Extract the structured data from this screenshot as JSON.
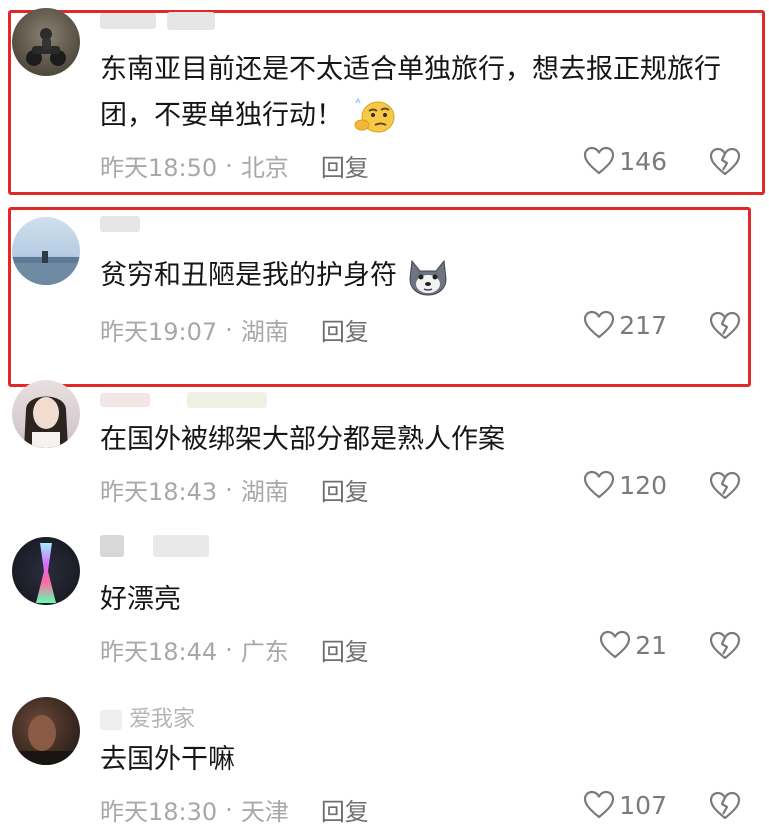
{
  "comments": [
    {
      "username": "",
      "text": "东南亚目前还是不太适合单独旅行，想去报正规旅行团，不要单独行动！",
      "time": "昨天18:50",
      "location": "北京",
      "reply_label": "回复",
      "likes": "146",
      "emoji": "thinking-emoji",
      "highlighted": true
    },
    {
      "username": "",
      "text": "贫穷和丑陋是我的护身符",
      "time": "昨天19:07",
      "location": "湖南",
      "reply_label": "回复",
      "likes": "217",
      "emoji": "husky-dog-emoji",
      "highlighted": true
    },
    {
      "username": "",
      "text": "在国外被绑架大部分都是熟人作案",
      "time": "昨天18:43",
      "location": "湖南",
      "reply_label": "回复",
      "likes": "120",
      "highlighted": false
    },
    {
      "username": "",
      "text": "好漂亮",
      "time": "昨天18:44",
      "location": "广东",
      "reply_label": "回复",
      "likes": "21",
      "highlighted": false
    },
    {
      "username": "爱我家",
      "text": "去国外干嘛",
      "time": "昨天18:30",
      "location": "天津",
      "reply_label": "回复",
      "likes": "107",
      "highlighted": false
    }
  ],
  "meta_separator": "·",
  "colors": {
    "highlight_border": "#e02a2a",
    "meta_text": "#a8a8a8",
    "body_text": "#161616"
  }
}
